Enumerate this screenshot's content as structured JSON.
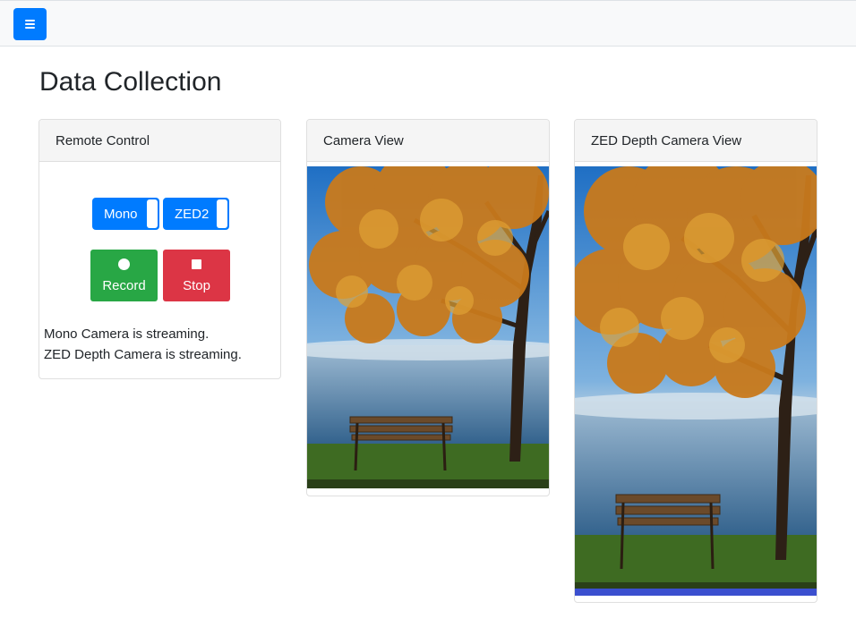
{
  "topbar": {
    "menu_icon": "hamburger-icon",
    "accent": "#007bff"
  },
  "page": {
    "title": "Data Collection"
  },
  "remote_control": {
    "header": "Remote Control",
    "toggles": [
      {
        "label": "Mono",
        "state": "on"
      },
      {
        "label": "ZED2",
        "state": "on"
      }
    ],
    "record_label": "Record",
    "stop_label": "Stop",
    "record_icon": "record-dot-icon",
    "stop_icon": "stop-square-icon",
    "status_lines": [
      "Mono Camera is streaming.",
      "ZED Depth Camera is streaming."
    ]
  },
  "camera_view": {
    "header": "Camera View"
  },
  "zed_view": {
    "header": "ZED Depth Camera View"
  },
  "colors": {
    "record": "#28a745",
    "stop": "#dc3545",
    "toggle": "#007bff"
  }
}
